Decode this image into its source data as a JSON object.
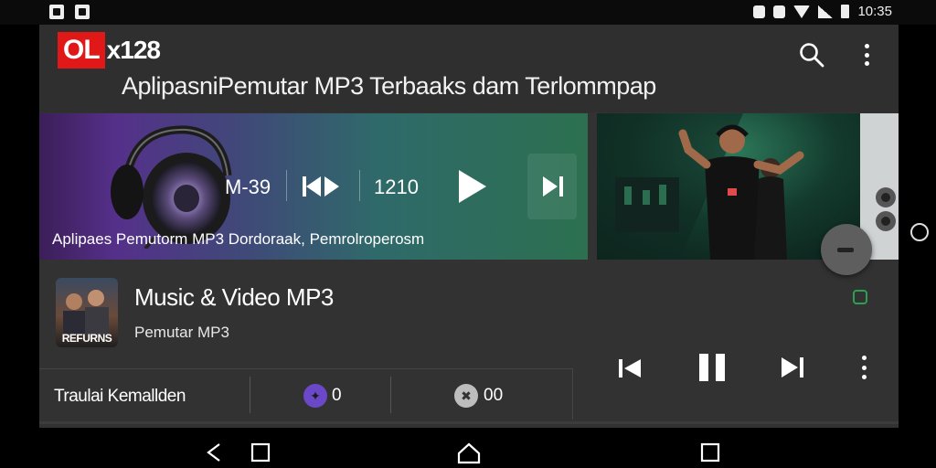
{
  "status_bar": {
    "time": "10:35",
    "left_icons": [
      "image-icon",
      "gallery-icon"
    ],
    "right_icons": [
      "alarm-icon",
      "notification-icon",
      "wifi-icon",
      "signal-icon",
      "battery-icon"
    ]
  },
  "header": {
    "logo_highlight": "OL",
    "logo_rest": "x128",
    "title": "AplipasniPemutar MP3 Terbaaks dam Terlommpap",
    "icons": [
      "search-icon",
      "more-vert-icon"
    ]
  },
  "banner": {
    "time": "M-39",
    "count": "1210",
    "caption": "Aplipaes Pemutorm MP3 Dordoraak, Pemrolroperosm",
    "icons": [
      "headphones-icon",
      "skip-previous-icon",
      "play-icon",
      "skip-next-icon"
    ]
  },
  "now_playing": {
    "thumbnail_label": "REFURNS",
    "title": "Music & Video MP3",
    "subtitle": "Pemutar MP3"
  },
  "stats": {
    "label": "Traulai Kemallden",
    "likes_badge": "✦",
    "likes_value": "0",
    "dislikes_badge": "✖",
    "dislikes_value": "00"
  },
  "player_controls": [
    "skip-previous-icon",
    "pause-icon",
    "skip-next-icon",
    "more-vert-icon"
  ],
  "nav_bar": [
    "back-icon",
    "recents-icon",
    "home-icon",
    "overview-icon"
  ],
  "colors": {
    "app_background": "#323232",
    "logo_red": "#e01818",
    "banner_start": "#55308a",
    "banner_end": "#2c7050",
    "accent_green": "#2d9e52",
    "badge_purple": "#6a48c8"
  }
}
